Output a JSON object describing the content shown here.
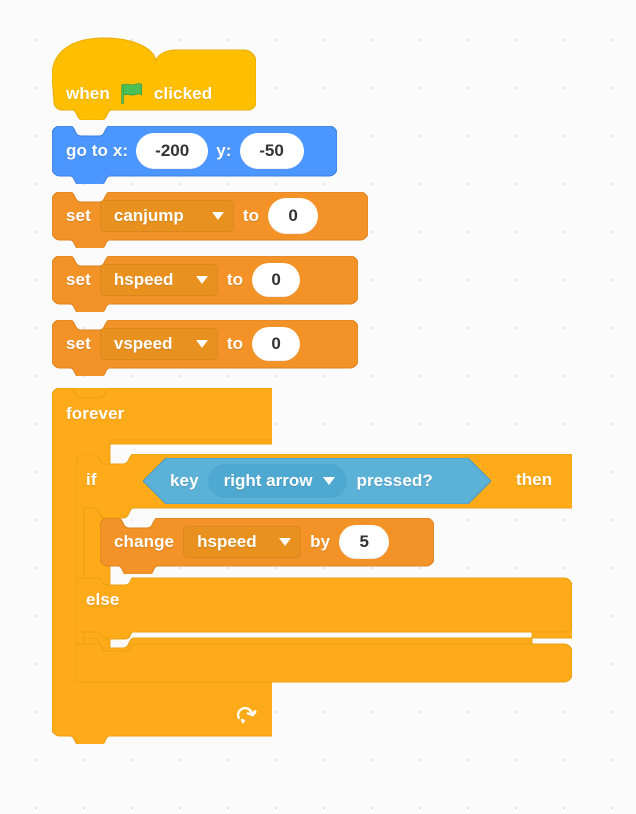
{
  "workspace": {
    "background_color": "#fbfbfb",
    "grid_dot_color": "#e6e6e6"
  },
  "palette": {
    "events_yellow": "#ffbf00",
    "motion_blue": "#4c97ff",
    "variables_orange": "#f29227",
    "variables_orange_dark": "#e8911f",
    "control_gold": "#ffab19",
    "control_gold_dark": "#f0a018",
    "sensing_blue": "#5cb1d6",
    "sensing_blue_dark": "#4fa8cf",
    "input_white": "#ffffff",
    "input_text": "#333333",
    "flag_green": "#4cbf56"
  },
  "script": {
    "hat": {
      "prefix": "when",
      "icon": "green-flag-icon",
      "suffix": "clicked"
    },
    "goto": {
      "label_x": "go to x:",
      "value_x": "-200",
      "label_y": "y:",
      "value_y": "-50"
    },
    "set_blocks": [
      {
        "verb": "set",
        "variable": "canjump",
        "preposition": "to",
        "value": "0"
      },
      {
        "verb": "set",
        "variable": "hspeed",
        "preposition": "to",
        "value": "0"
      },
      {
        "verb": "set",
        "variable": "vspeed",
        "preposition": "to",
        "value": "0"
      }
    ],
    "forever": {
      "label": "forever",
      "loop_icon": "loop-arrow-icon"
    },
    "if_else": {
      "if_label": "if",
      "then_label": "then",
      "else_label": "else",
      "condition": {
        "prefix": "key",
        "key_option": "right arrow",
        "suffix": "pressed?",
        "dropdown_icon": "chevron-down-icon"
      },
      "then_body": [
        {
          "verb": "change",
          "variable": "hspeed",
          "preposition": "by",
          "value": "5"
        }
      ],
      "else_body": []
    }
  }
}
